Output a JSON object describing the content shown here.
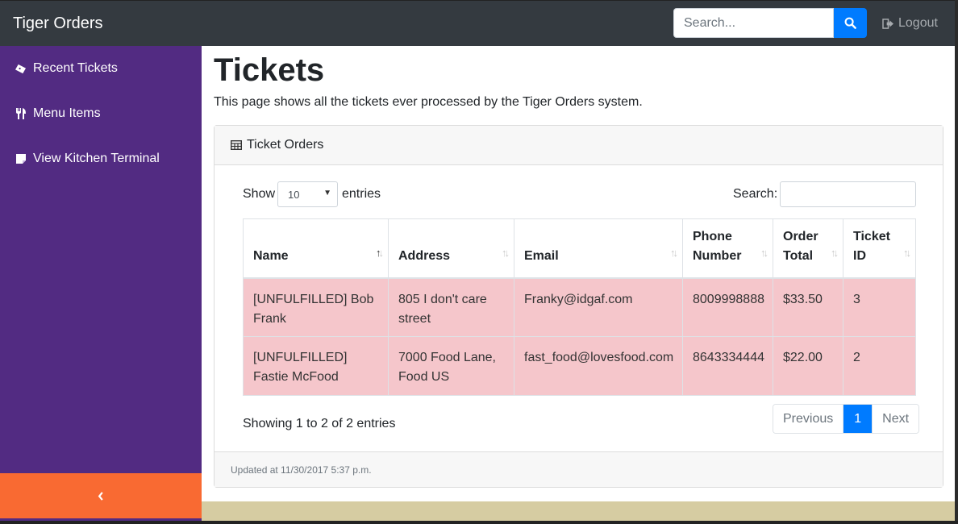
{
  "app": {
    "brand": "Tiger Orders"
  },
  "navbar": {
    "search_placeholder": "Search...",
    "search_icon": "search-icon",
    "logout_label": "Logout",
    "logout_icon": "sign-out-icon"
  },
  "sidebar": {
    "items": [
      {
        "label": "Recent Tickets",
        "icon": "ticket-icon"
      },
      {
        "label": "Menu Items",
        "icon": "cutlery-icon"
      },
      {
        "label": "View Kitchen Terminal",
        "icon": "sticky-note-icon"
      }
    ],
    "collapse_icon": "chevron-left-icon"
  },
  "page": {
    "title": "Tickets",
    "description": "This page shows all the tickets ever processed by the Tiger Orders system."
  },
  "card": {
    "header_label": "Ticket Orders",
    "header_icon": "table-icon",
    "footer_text": "Updated at 11/30/2017 5:37 p.m."
  },
  "table_controls": {
    "show_label": "Show",
    "entries_value": "10",
    "entries_label": "entries",
    "search_label": "Search:",
    "search_value": ""
  },
  "table": {
    "columns": [
      "Name",
      "Address",
      "Email",
      "Phone Number",
      "Order Total",
      "Ticket ID"
    ],
    "sorted_column": "Name",
    "rows": [
      {
        "name": "[UNFULFILLED] Bob Frank",
        "address": "805 I don't care street",
        "email": "Franky@idgaf.com",
        "phone": "8009998888",
        "total": "$33.50",
        "id": "3"
      },
      {
        "name": "[UNFULFILLED] Fastie McFood",
        "address": "7000 Food Lane, Food US",
        "email": "fast_food@lovesfood.com",
        "phone": "8643334444",
        "total": "$22.00",
        "id": "2"
      }
    ],
    "row_color": "#f5c6cb"
  },
  "pagination": {
    "info": "Showing 1 to 2 of 2 entries",
    "previous": "Previous",
    "current": "1",
    "next": "Next"
  },
  "colors": {
    "navbar": "#343a40",
    "sidebar": "#522b82",
    "collapse_bar": "#f96a32",
    "primary": "#007bff"
  }
}
